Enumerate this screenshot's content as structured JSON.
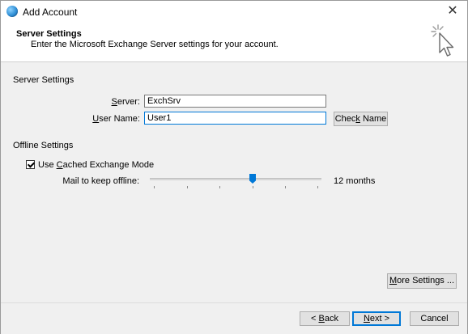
{
  "window": {
    "title": "Add Account"
  },
  "header": {
    "title": "Server Settings",
    "description": "Enter the Microsoft Exchange Server settings for your account."
  },
  "server_settings": {
    "section_label": "Server Settings",
    "server_label_pre": "",
    "server_label_access": "S",
    "server_label_post": "erver:",
    "server_value": "ExchSrv",
    "username_label_pre": "",
    "username_label_access": "U",
    "username_label_post": "ser Name:",
    "username_value": "User1",
    "check_name_pre": "Chec",
    "check_name_access": "k",
    "check_name_post": " Name"
  },
  "offline_settings": {
    "section_label": "Offline Settings",
    "cached_pre": "Use ",
    "cached_access": "C",
    "cached_post": "ached Exchange Mode",
    "cached_checked": true,
    "mail_offline_label": "Mail to keep offline:",
    "slider_value_text": "12 months",
    "slider_fraction": 0.6
  },
  "buttons": {
    "more_settings_pre": "",
    "more_settings_access": "M",
    "more_settings_post": "ore Settings ...",
    "back_pre": "< ",
    "back_access": "B",
    "back_post": "ack",
    "next_pre": "",
    "next_access": "N",
    "next_post": "ext >",
    "cancel": "Cancel"
  }
}
